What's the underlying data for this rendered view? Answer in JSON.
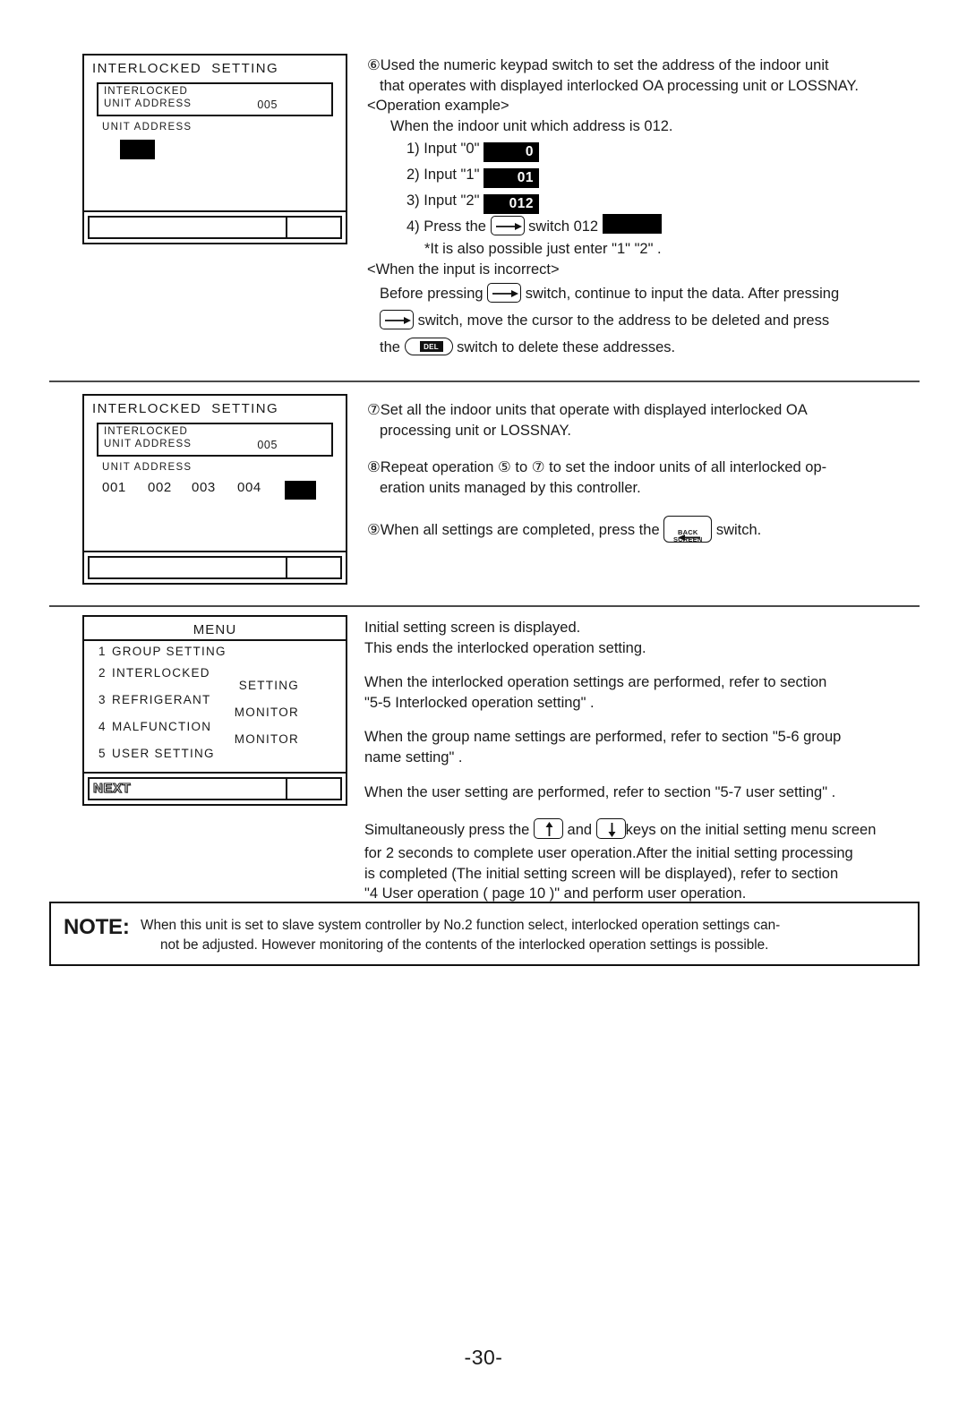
{
  "page": {
    "number": "-30-"
  },
  "panels": {
    "interlocked_setting_1": {
      "title": "INTERLOCKED  SETTING",
      "box_line1": "INTERLOCKED",
      "box_line2": "UNIT ADDRESS",
      "box_value": "005",
      "field_label": "UNIT ADDRESS",
      "addresses": [],
      "footer_label": ""
    },
    "interlocked_setting_2": {
      "title": "INTERLOCKED  SETTING",
      "box_line1": "INTERLOCKED",
      "box_line2": "UNIT ADDRESS",
      "box_value": "005",
      "field_label": "UNIT ADDRESS",
      "addresses": [
        "001",
        "002",
        "003",
        "004"
      ],
      "footer_label": ""
    },
    "menu": {
      "title": "MENU",
      "items": [
        {
          "num": "1",
          "label": "GROUP SETTING",
          "cont": ""
        },
        {
          "num": "2",
          "label": "INTERLOCKED",
          "cont": "SETTING"
        },
        {
          "num": "3",
          "label": "REFRIGERANT",
          "cont": "MONITOR"
        },
        {
          "num": "4",
          "label": "MALFUNCTION",
          "cont": "MONITOR"
        },
        {
          "num": "5",
          "label": "USER SETTING",
          "cont": ""
        }
      ],
      "footer_label": "NEXT"
    }
  },
  "section1": {
    "step6_marker": "⑥",
    "step6_line1": "Used the numeric keypad switch to set the address of the indoor unit",
    "step6_line2": "that operates with displayed interlocked OA processing unit or LOSSNAY.",
    "operation_example_heading": "<Operation example>",
    "operation_example_intro": "When the indoor unit which address is 012.",
    "steps": [
      {
        "label": "1) Input \"0\"",
        "chip": "0"
      },
      {
        "label": "2) Input \"1\"",
        "chip": "01"
      },
      {
        "label": "3) Input \"2\"",
        "chip": "012"
      }
    ],
    "step4_pre": "4) Press the",
    "step4_mid": "switch 012",
    "step4_chip": "",
    "note_asterisk": "*It is also possible just enter \"1\" \"2\" .",
    "incorrect_heading": "<When the input is incorrect>",
    "incorrect_line1a": "Before pressing",
    "incorrect_line1b": "switch, continue to input the data. After pressing",
    "incorrect_line2b": "switch, move the cursor to the address to be deleted and press",
    "incorrect_line3a": "the",
    "incorrect_line3b": "switch to delete these addresses.",
    "icon_arrow_right": "arrow-right-key",
    "icon_del": "del-key"
  },
  "section2": {
    "step7_marker": "⑦",
    "step7_line1": "Set all the indoor units that operate with displayed interlocked OA",
    "step7_line2": "processing unit or LOSSNAY.",
    "step8_marker": "⑧",
    "step8_a": "Repeat operation",
    "step8_ref1": "⑤",
    "step8_b": "to",
    "step8_ref2": "⑦",
    "step8_c": "to set the indoor units of all interlocked op-",
    "step8_line2": "eration units managed by this controller.",
    "step9_marker": "⑨",
    "step9_a": "When all settings are completed, press the",
    "step9_b": "switch.",
    "backscreen_l1": "BACK",
    "backscreen_l2": "SCREEN"
  },
  "section3": {
    "para1_line1": "Initial setting screen is displayed.",
    "para1_line2": "This ends the interlocked operation setting.",
    "para2_line1": "When the interlocked operation settings are performed, refer to section",
    "para2_line2": "\"5-5 Interlocked operation setting\" .",
    "para3_line1": "When the group name settings are performed, refer to section \"5-6 group",
    "para3_line2": "name setting\" .",
    "para4_line1": "When the user setting are performed, refer to section \"5-7 user setting\" .",
    "para5_a": "Simultaneously press the",
    "para5_b": "and",
    "para5_c": "keys on the initial setting menu screen",
    "para5_line2": "for 2 seconds to complete user operation.After the initial setting processing",
    "para5_line3": "is completed (The initial setting screen will be displayed), refer to section",
    "para5_line4": "\"4 User operation ( page 10 )\" and perform user operation."
  },
  "note": {
    "label": "NOTE:",
    "line1": "When this unit is set to slave system controller by No.2 function select, interlocked operation settings can-",
    "line2": "not be adjusted. However monitoring of the contents of the interlocked operation settings is possible."
  },
  "colors": {
    "ink": "#1a1a1a",
    "rule": "#4a4a4a",
    "lcd_cursor": "#000000"
  }
}
